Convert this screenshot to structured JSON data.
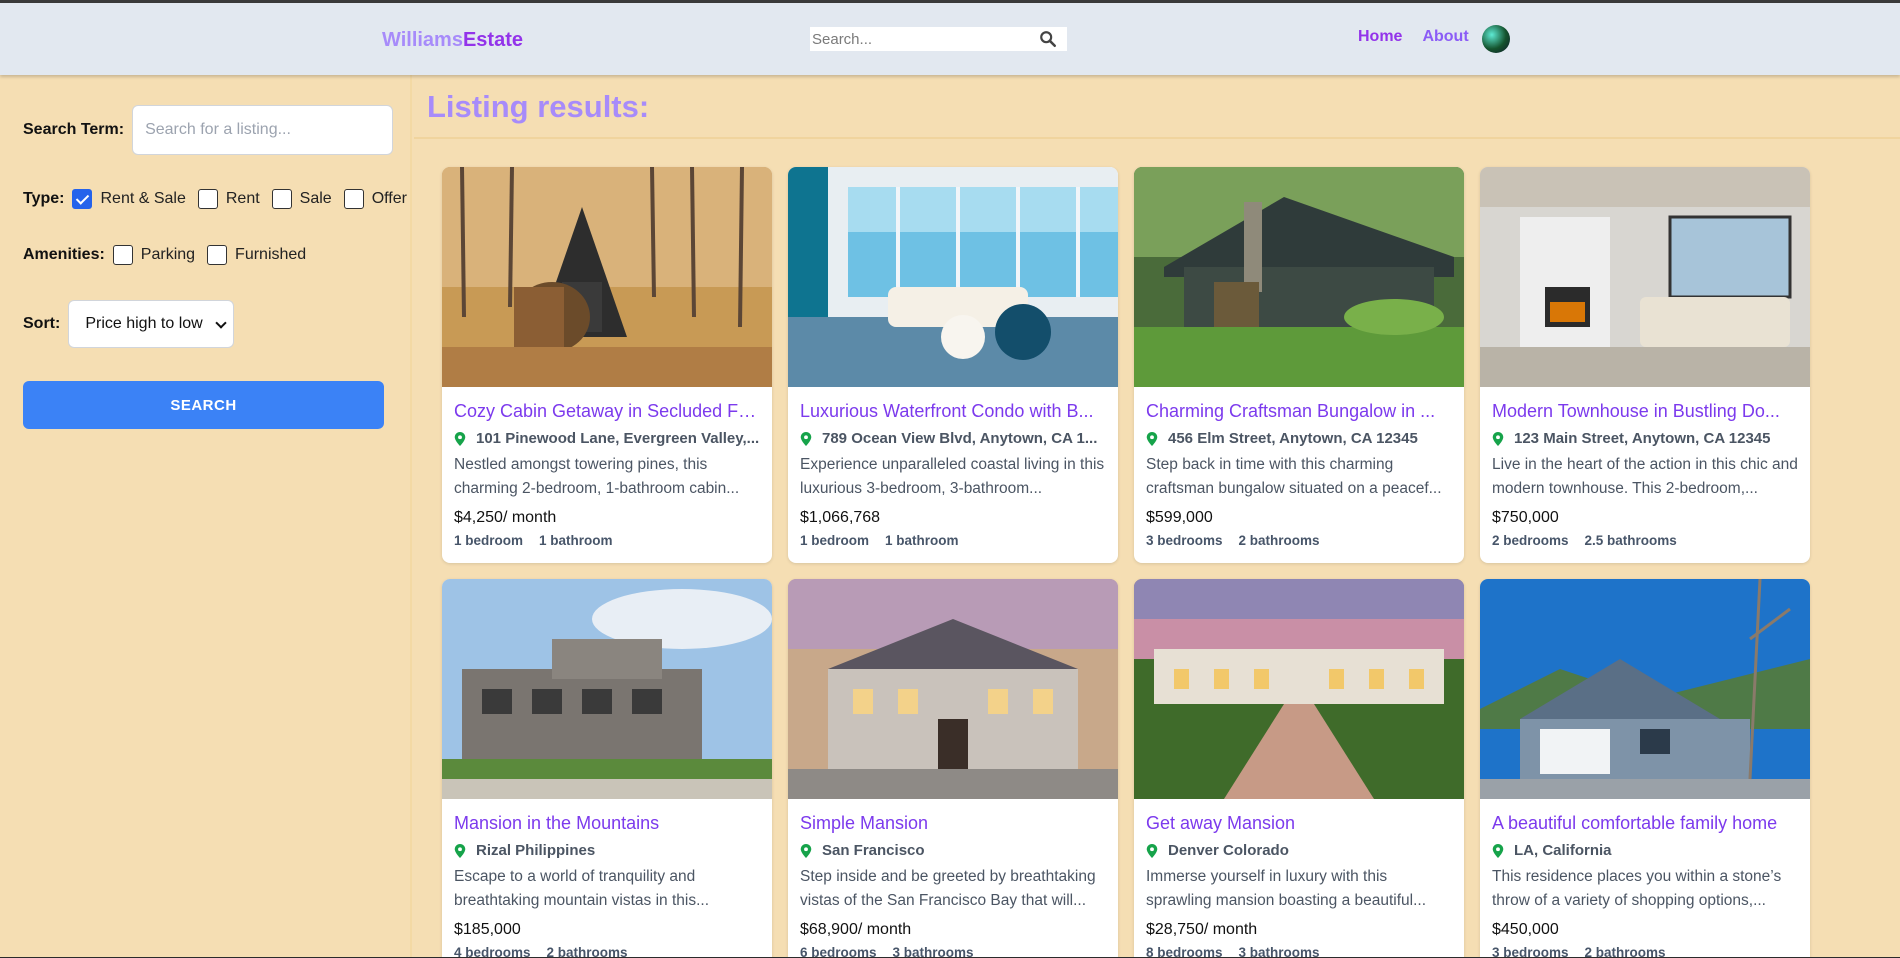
{
  "header": {
    "logo_part1": "Williams",
    "logo_part2": "Estate",
    "search_placeholder": "Search...",
    "nav": {
      "home": "Home",
      "about": "About"
    }
  },
  "sidebar": {
    "search_term_label": "Search Term:",
    "search_term_placeholder": "Search for a listing...",
    "type_label": "Type:",
    "type_options": [
      {
        "label": "Rent & Sale",
        "checked": true
      },
      {
        "label": "Rent",
        "checked": false
      },
      {
        "label": "Sale",
        "checked": false
      },
      {
        "label": "Offer",
        "checked": false
      }
    ],
    "amenities_label": "Amenities:",
    "amenity_options": [
      {
        "label": "Parking",
        "checked": false
      },
      {
        "label": "Furnished",
        "checked": false
      }
    ],
    "sort_label": "Sort:",
    "sort_value": "Price high to low",
    "search_button": "SEARCH"
  },
  "main": {
    "results_title": "Listing results:",
    "listings": [
      {
        "title": "Cozy Cabin Getaway in Secluded Fo...",
        "address": "101 Pinewood Lane, Evergreen Valley,...",
        "description": "Nestled amongst towering pines, this charming 2-bedroom, 1-bathroom cabin...",
        "price": "$4,250/ month",
        "bedrooms": "1 bedroom",
        "bathrooms": "1 bathroom"
      },
      {
        "title": "Luxurious Waterfront Condo with B...",
        "address": "789 Ocean View Blvd, Anytown, CA 1...",
        "description": "Experience unparalleled coastal living in this luxurious 3-bedroom, 3-bathroom...",
        "price": "$1,066,768",
        "bedrooms": "1 bedroom",
        "bathrooms": "1 bathroom"
      },
      {
        "title": "Charming Craftsman Bungalow in ...",
        "address": "456 Elm Street, Anytown, CA 12345",
        "description": "Step back in time with this charming craftsman bungalow situated on a peacef...",
        "price": "$599,000",
        "bedrooms": "3 bedrooms",
        "bathrooms": "2 bathrooms"
      },
      {
        "title": "Modern Townhouse in Bustling Do...",
        "address": "123 Main Street, Anytown, CA 12345",
        "description": "Live in the heart of the action in this chic and modern townhouse. This 2-bedroom,...",
        "price": "$750,000",
        "bedrooms": "2 bedrooms",
        "bathrooms": "2.5 bathrooms"
      },
      {
        "title": "Mansion in the Mountains",
        "address": "Rizal Philippines",
        "description": "Escape to a world of tranquility and breathtaking mountain vistas in this...",
        "price": "$185,000",
        "bedrooms": "4 bedrooms",
        "bathrooms": "2 bathrooms"
      },
      {
        "title": "Simple Mansion",
        "address": "San Francisco",
        "description": "Step inside and be greeted by breathtaking vistas of the San Francisco Bay that will...",
        "price": "$68,900/ month",
        "bedrooms": "6 bedrooms",
        "bathrooms": "3 bathrooms"
      },
      {
        "title": "Get away Mansion",
        "address": "Denver Colorado",
        "description": "Immerse yourself in luxury with this sprawling mansion boasting a beautiful...",
        "price": "$28,750/ month",
        "bedrooms": "8 bedrooms",
        "bathrooms": "3 bathrooms"
      },
      {
        "title": "A beautiful comfortable family home",
        "address": "LA, California",
        "description": "This residence places you within a stone’s throw of a variety of shopping options,...",
        "price": "$450,000",
        "bedrooms": "3 bedrooms",
        "bathrooms": "2 bathrooms"
      }
    ]
  },
  "icons": {
    "search": "search-icon",
    "pin": "map-pin-icon",
    "avatar": "user-avatar"
  },
  "colors": {
    "background": "#f5deb3",
    "header": "#e2e8f0",
    "accent": "#9333ea",
    "button": "#3b82f6",
    "pin": "#16a34a"
  }
}
